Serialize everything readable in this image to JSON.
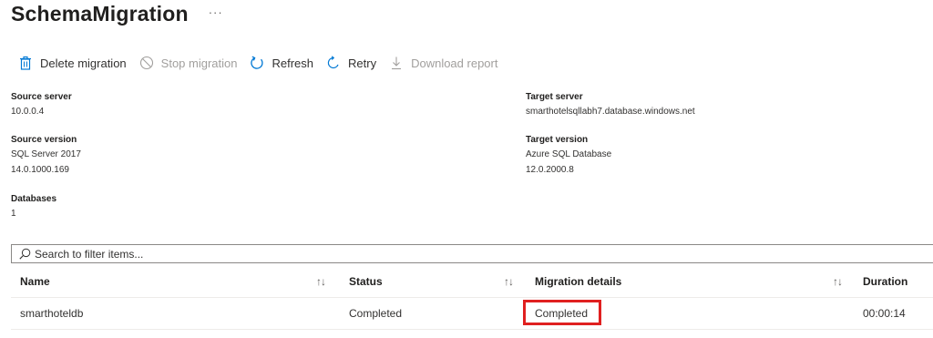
{
  "header": {
    "title": "SchemaMigration",
    "more": "···"
  },
  "toolbar": {
    "delete_label": "Delete migration",
    "stop_label": "Stop migration",
    "refresh_label": "Refresh",
    "retry_label": "Retry",
    "download_label": "Download report"
  },
  "source": {
    "server_label": "Source server",
    "server_value": "10.0.0.4",
    "version_label": "Source version",
    "version_line1": "SQL Server 2017",
    "version_line2": "14.0.1000.169",
    "databases_label": "Databases",
    "databases_value": "1"
  },
  "target": {
    "server_label": "Target server",
    "server_value": "smarthotelsqllabh7.database.windows.net",
    "version_label": "Target version",
    "version_line1": "Azure SQL Database",
    "version_line2": "12.0.2000.8"
  },
  "search": {
    "placeholder": "Search to filter items..."
  },
  "table": {
    "columns": [
      "Name",
      "Status",
      "Migration details",
      "Duration"
    ],
    "sort_glyph": "↑↓",
    "rows": [
      {
        "name": "smarthoteldb",
        "status": "Completed",
        "details": "Completed",
        "duration": "00:00:14"
      }
    ]
  },
  "colors": {
    "highlight": "#e02020",
    "accent": "#0078d4",
    "disabled": "#a19f9d"
  }
}
